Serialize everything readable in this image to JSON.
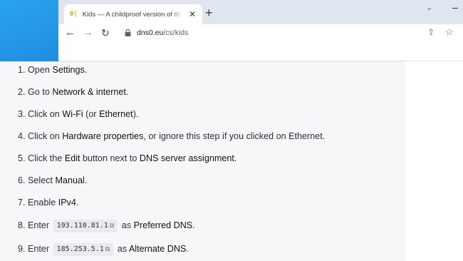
{
  "browser": {
    "tab_title": "Kids — A childproof version of th",
    "tab_favicon": "0|",
    "url_host": "dns0.eu",
    "url_path": "/cs/kids"
  },
  "steps": [
    {
      "n": "1.",
      "pre": "Open ",
      "b1": "Settings",
      "post": "."
    },
    {
      "n": "2.",
      "pre": "Go to ",
      "b1": "Network & internet",
      "post": "."
    },
    {
      "n": "3.",
      "pre": "Click on ",
      "b1": "Wi-Fi",
      "mid": " (or ",
      "b2": "Ethernet",
      "post": ")."
    },
    {
      "n": "4.",
      "pre": "Click on ",
      "b1": "Hardware properties",
      "post": ", or ignore this step if you clicked on Ethernet."
    },
    {
      "n": "5.",
      "pre": "Click the ",
      "b1": "Edit",
      "mid": " button next to ",
      "b2": "DNS server assignment",
      "post": "."
    },
    {
      "n": "6.",
      "pre": "Select ",
      "b1": "Manual",
      "post": "."
    },
    {
      "n": "7.",
      "pre": "Enable ",
      "b1": "IPv4",
      "post": "."
    },
    {
      "n": "8.",
      "pre": "Enter ",
      "code": "193.110.81.1",
      "mid": " as ",
      "b2": "Preferred DNS",
      "post": "."
    },
    {
      "n": "9.",
      "pre": "Enter ",
      "code": "185.253.5.1",
      "mid": " as ",
      "b2": "Alternate DNS",
      "post": "."
    }
  ]
}
